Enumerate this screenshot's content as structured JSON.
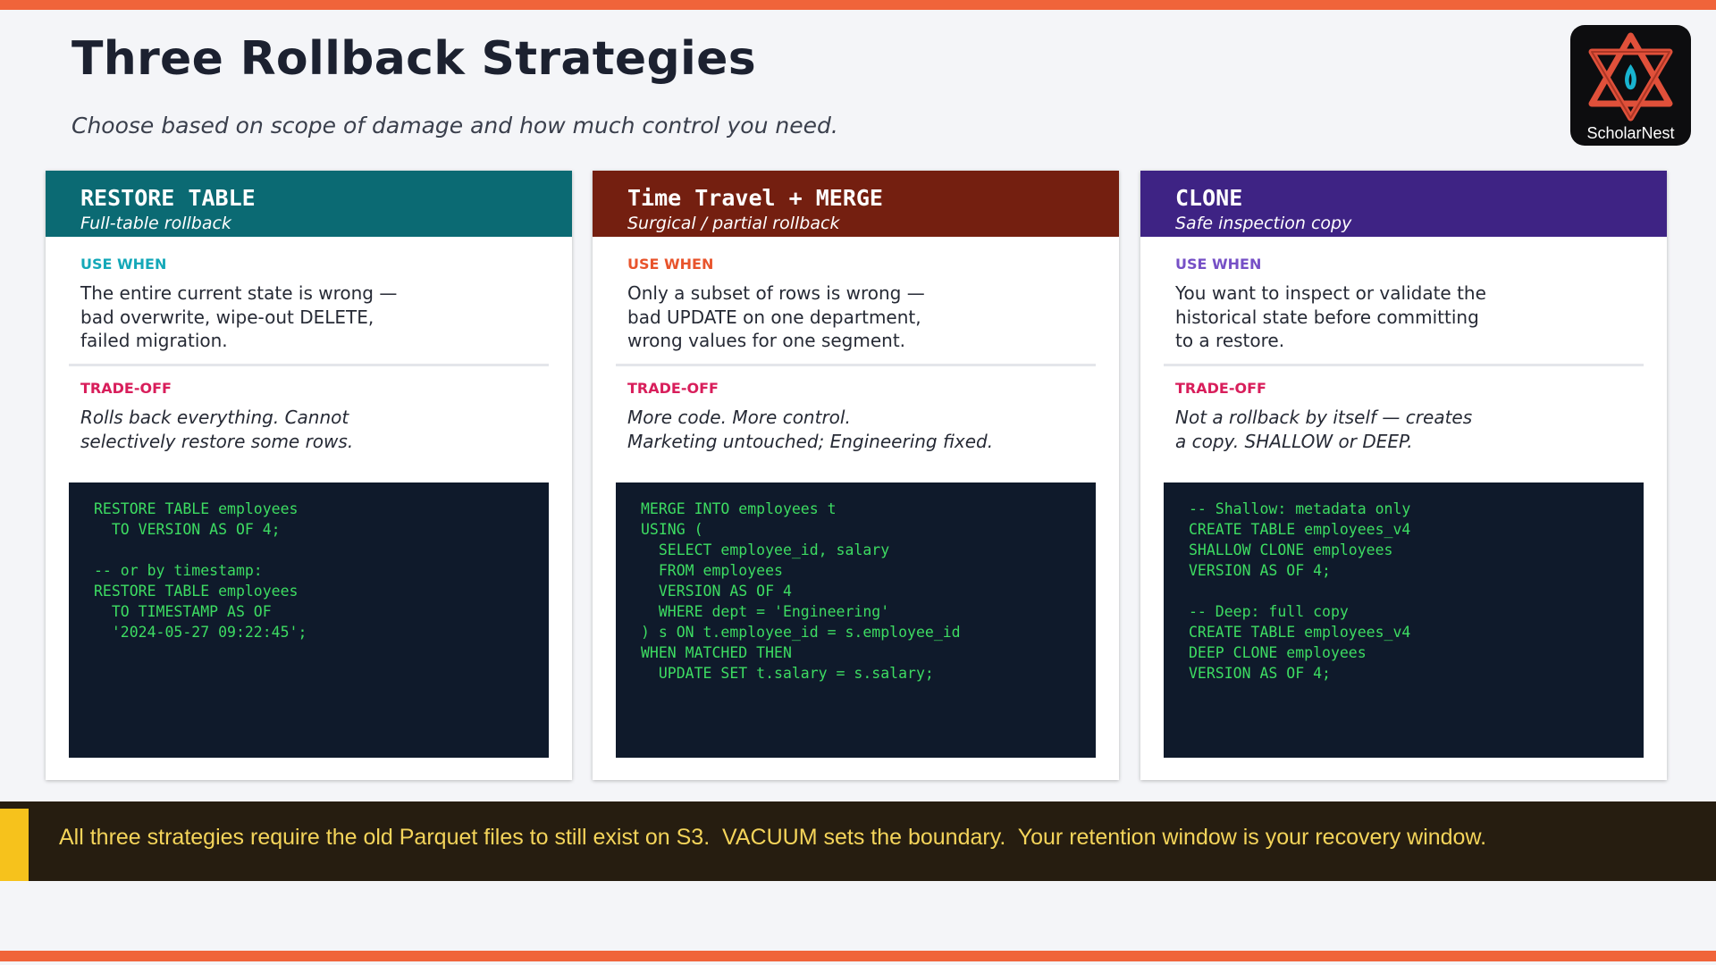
{
  "page": {
    "title": "Three Rollback Strategies",
    "subtitle": "Choose based on scope of damage and how much control you need."
  },
  "logo": {
    "text": "ScholarNest"
  },
  "cards": [
    {
      "title": "RESTORE TABLE",
      "tagline": "Full-table rollback",
      "use_label": "USE WHEN",
      "use_text": "The entire current state is wrong —\nbad overwrite, wipe-out DELETE,\nfailed migration.",
      "trade_label": "TRADE-OFF",
      "trade_text": "Rolls back everything. Cannot\nselectively restore some rows.",
      "code": "RESTORE TABLE employees\n  TO VERSION AS OF 4;\n\n-- or by timestamp:\nRESTORE TABLE employees\n  TO TIMESTAMP AS OF\n  '2024-05-27 09:22:45';"
    },
    {
      "title": "Time Travel + MERGE",
      "tagline": "Surgical / partial rollback",
      "use_label": "USE WHEN",
      "use_text": "Only a subset of rows is wrong —\nbad UPDATE on one department,\nwrong values for one segment.",
      "trade_label": "TRADE-OFF",
      "trade_text": "More code. More control.\nMarketing untouched; Engineering fixed.",
      "code": "MERGE INTO employees t\nUSING (\n  SELECT employee_id, salary\n  FROM employees\n  VERSION AS OF 4\n  WHERE dept = 'Engineering'\n) s ON t.employee_id = s.employee_id\nWHEN MATCHED THEN\n  UPDATE SET t.salary = s.salary;"
    },
    {
      "title": "CLONE",
      "tagline": "Safe inspection copy",
      "use_label": "USE WHEN",
      "use_text": "You want to inspect or validate the\nhistorical state before committing\nto a restore.",
      "trade_label": "TRADE-OFF",
      "trade_text": "Not a rollback by itself — creates\na copy. SHALLOW or DEEP.",
      "code": "-- Shallow: metadata only\nCREATE TABLE employees_v4\nSHALLOW CLONE employees\nVERSION AS OF 4;\n\n-- Deep: full copy\nCREATE TABLE employees_v4\nDEEP CLONE employees\nVERSION AS OF 4;"
    }
  ],
  "banner": {
    "text": "All three strategies require the old Parquet files to still exist on S3.  VACUUM sets the boundary.  Your retention window is your recovery window."
  },
  "colors": {
    "accent_bar": "#f0643a",
    "card1_header": "#0b6a73",
    "card2_header": "#741f10",
    "card3_header": "#3e2384",
    "code_bg": "#0f1a2b",
    "code_text": "#3ddc62",
    "banner_bg": "#261d10",
    "banner_accent": "#f6c21c",
    "banner_text": "#f4d45a"
  }
}
